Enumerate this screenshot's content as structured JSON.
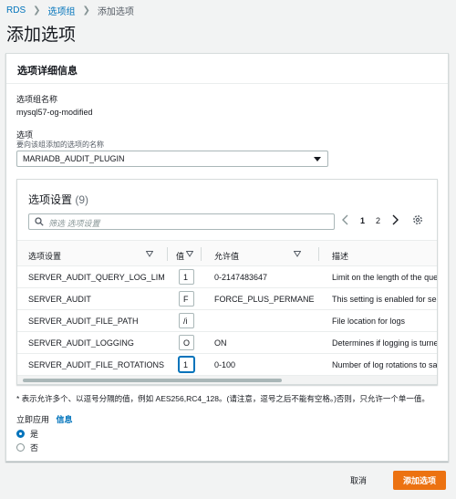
{
  "breadcrumb": {
    "root": "RDS",
    "parent": "选项组",
    "current": "添加选项"
  },
  "page_title": "添加选项",
  "panel": {
    "title": "选项详细信息",
    "group_name_label": "选项组名称",
    "group_name_value": "mysql57-og-modified",
    "option_label": "选项",
    "option_desc": "要向该组添加的选项的名称",
    "option_selected": "MARIADB_AUDIT_PLUGIN"
  },
  "settings_table": {
    "title": "选项设置",
    "count": "(9)",
    "search_placeholder": "筛选 选项设置",
    "pages": [
      "1",
      "2"
    ],
    "columns": [
      "选项设置",
      "值",
      "允许值",
      "描述"
    ],
    "rows": [
      {
        "name": "SERVER_AUDIT_QUERY_LOG_LIMIT",
        "value": "1",
        "allowed": "0-2147483647",
        "description": "Limit on the length of the que"
      },
      {
        "name": "SERVER_AUDIT",
        "value": "F",
        "allowed": "FORCE_PLUS_PERMANENT",
        "description": "This setting is enabled for secu"
      },
      {
        "name": "SERVER_AUDIT_FILE_PATH",
        "value": "/i",
        "allowed": "",
        "description": "File location for logs"
      },
      {
        "name": "SERVER_AUDIT_LOGGING",
        "value": "O",
        "allowed": "ON",
        "description": "Determines if logging is turned"
      },
      {
        "name": "SERVER_AUDIT_FILE_ROTATIONS",
        "value": "1",
        "allowed": "0-100",
        "description": "Number of log rotations to sav"
      }
    ]
  },
  "footnote": "* 表示允许多个、以逗号分隔的值，例如 AES256,RC4_128。(请注意，逗号之后不能有空格。)否则，只允许一个单一值。",
  "apply_immediately": {
    "label": "立即应用",
    "info": "信息",
    "options": [
      "是",
      "否"
    ],
    "selected": "是"
  },
  "actions": {
    "cancel": "取消",
    "submit": "添加选项"
  },
  "colors": {
    "accent": "#0073bb",
    "primary": "#ec7211"
  }
}
